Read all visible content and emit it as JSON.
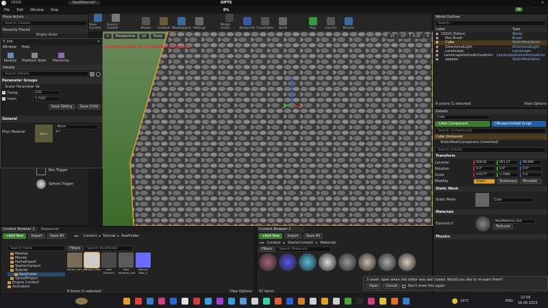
{
  "window": {
    "tab1": "DDDD",
    "tab2": "NewMaterial*",
    "title": "GIFTS",
    "progress": "0%",
    "user": "Ty"
  },
  "menu": [
    "File",
    "Edit",
    "Window",
    "Help"
  ],
  "toolbar": [
    {
      "label": "Save Current",
      "c": "#3c6aa0"
    },
    {
      "label": "Source Control",
      "c": "#777"
    },
    {
      "label": "Modes",
      "c": "#555"
    },
    {
      "label": "Content",
      "c": "#6a5a3a"
    },
    {
      "label": "Marketplace",
      "c": "#3a6a9a"
    },
    {
      "label": "Settings",
      "c": "#666"
    },
    {
      "label": "Merge Actors",
      "c": "#444"
    },
    {
      "label": "Blueprints",
      "c": "#3a5aa0"
    },
    {
      "label": "Cinematics",
      "c": "#555"
    },
    {
      "label": "Build",
      "c": "#666"
    },
    {
      "label": "Play",
      "c": "#3a9a3a"
    },
    {
      "label": "Launch",
      "c": "#555"
    },
    {
      "label": "Browse",
      "c": "#3a6aa0"
    }
  ],
  "place": {
    "tab": "Place Actors",
    "search": "Search Classes",
    "recent": "Recently Placed",
    "empty": "Empty Actor",
    "items": [
      "Box Trigger",
      "Sphere Trigger"
    ]
  },
  "float": {
    "title": "0_inst",
    "menu": [
      "Window",
      "Help"
    ],
    "btns": [
      "Params",
      "Platform Stats",
      "Hierarchy"
    ],
    "details": "Details",
    "search": "Search Details",
    "group": "Parameter Groups",
    "sub": "Scalar Parameter Va",
    "p1": {
      "name": "Hump",
      "val": "0.02"
    },
    "p2": {
      "name": "Inten",
      "val": "1.7542"
    },
    "save": "Save Sibling",
    "savechild": "Save Child",
    "general": "General",
    "phys": "Phys Material",
    "none": "None",
    "thumb": "None"
  },
  "viewport": {
    "mode": "Perspective",
    "lit": "Lit",
    "show": "Show",
    "warn": "LIGHTING NEEDS TO BE REBUILT (50 unbuilt)"
  },
  "outliner": {
    "tab": "World Outliner",
    "search": "Search...",
    "h1": "Label",
    "h2": "Type",
    "rows": [
      {
        "l": "DDDD (Editor)",
        "t": "World"
      },
      {
        "l": "Box Brush",
        "t": "Brush"
      },
      {
        "l": "Cube",
        "t": "StaticMeshActor"
      },
      {
        "l": "DirectionalLight",
        "t": "DirectionalLight"
      },
      {
        "l": "Landscape",
        "t": "Landscape"
      },
      {
        "l": "LandscapeGizmoActiveActor",
        "t": "LandscapeGizmoActiveActor"
      },
      {
        "l": "дерево",
        "t": "StaticMeshActor"
      }
    ],
    "count": "6 actors (1 selected)",
    "view": "View Options"
  },
  "details": {
    "tab": "Details",
    "name": "Cube",
    "add": "Add Component",
    "bp": "Blueprint/Add Script",
    "search": "Search Components",
    "comp1": "Cube (Instance)",
    "comp2": "StaticMeshComponent (Inherited)",
    "search2": "Search Details",
    "transform": "Transform",
    "loc": "Location",
    "rot": "Rotation",
    "scale": "Scale",
    "mob": "Mobility",
    "lv": [
      "828.62",
      "951.57",
      "99.999"
    ],
    "rv": [
      "0.0°",
      "0.0°",
      "0.0°"
    ],
    "sv": [
      "4.6177",
      "3.7066",
      "1.0"
    ],
    "m": [
      "Static",
      "Stationary",
      "Movable"
    ],
    "sm": "Static Mesh",
    "smlabel": "Static Mesh",
    "smval": "Cube",
    "mats": "Materials",
    "el": "Element 0",
    "matval": "NewMaterial_Inst",
    "tex": "Textures",
    "physics": "Physics"
  },
  "cb1": {
    "tab": "Content Browser 1",
    "tab2": "Sequencer",
    "add": "Add New",
    "imp": "Import",
    "save": "Save All",
    "crumb": [
      "Content",
      "Tutorial",
      "NewFolder"
    ],
    "search": "Search Paths",
    "filters": "Filters",
    "search2": "Search NewFolder",
    "tree": [
      "Meshes",
      "Movies",
      "PashaExport",
      "StarterContent",
      "Tutorial",
      "NewFolder",
      "VproofProject",
      "Engine Content",
      "Animation"
    ],
    "assets": [
      {
        "n": "terrain_dirt_14",
        "c": "#7a6a5a"
      },
      {
        "n": "Dragon_Map",
        "c": "#ccc"
      },
      {
        "n": "New Material",
        "c": "#4a4a4a"
      },
      {
        "n": "New Material_Inst",
        "c": "#5a5a5a"
      },
      {
        "n": "Normal Map_2",
        "c": "#6a6aff"
      }
    ],
    "count": "9 items (1 selected)",
    "view": "View Options"
  },
  "cb2": {
    "tab": "Content Browser 2",
    "add": "Add New",
    "imp": "Import",
    "save": "Save All",
    "crumb": [
      "Content",
      "StarterContent",
      "Materials"
    ],
    "filters": "Filters",
    "search": "Search Materials",
    "assets": [
      {
        "c": "#aa6677"
      },
      {
        "c": "#5555ee"
      },
      {
        "c": "#55bbdd"
      },
      {
        "c": "#ddd"
      },
      {
        "c": "#999"
      },
      {
        "c": "#ccbbaa"
      },
      {
        "c": "#aaa"
      },
      {
        "c": "#ddccbb"
      }
    ],
    "count": "47 items"
  },
  "notice": {
    "text": "3 asset: open when the editor was last closed. Would you like to re-open them?",
    "open": "Open",
    "cancel": "Cancel",
    "dont": "Don't show this again"
  },
  "taskbar": {
    "temp": "19°C",
    "lang": "ENG",
    "time": "22:56",
    "date": "16.06.2023",
    "icons": [
      "#e0a030",
      "#e04040",
      "#3a7ad0",
      "#d04080",
      "#2a6ad0",
      "#e0e0e0",
      "#d04040",
      "#3aa0e0",
      "#a040d0",
      "#3a9ae0",
      "#5a9ad0",
      "#d0d0d0",
      "#3ad0a0",
      "#e06030",
      "#3060d0",
      "#d08030",
      "#d0d0d0",
      "#e0a020",
      "#d0d0d0",
      "#50a040",
      "#2a2a2a",
      "#d04080",
      "#e0c040",
      "#e07030",
      "#3a7ad0"
    ]
  },
  "colors": {
    "accent": "#e0a030",
    "sel": "#4a3a20"
  }
}
